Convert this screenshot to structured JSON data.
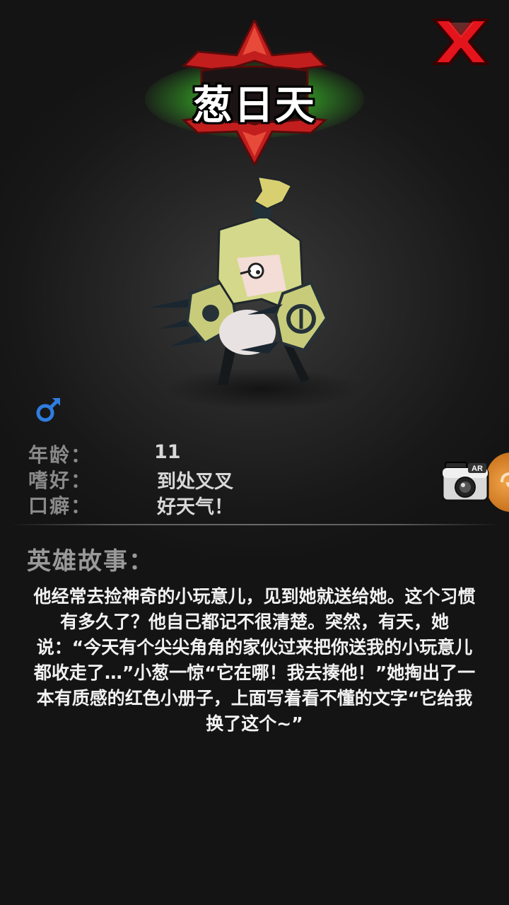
{
  "hero": {
    "name": "葱日天"
  },
  "profile": {
    "gender_icon": "male-symbol-icon",
    "gender_color": "#2f7de0",
    "rows": [
      {
        "label": "年龄：",
        "value": "11"
      },
      {
        "label": "嗜好：",
        "value": "到处叉叉"
      },
      {
        "label": "口癖：",
        "value": "好天气！"
      }
    ]
  },
  "ar_button": {
    "label": "AR",
    "icon": "camera-icon"
  },
  "story": {
    "heading": "英雄故事：",
    "text": "他经常去捡神奇的小玩意儿，见到她就送给她。这个习惯有多久了？他自己都记不很清楚。突然，有天，她说：“今天有个尖尖角角的家伙过来把你送我的小玩意儿都收走了…”小葱一惊“它在哪！我去揍他！”她掏出了一本有质感的红色小册子，上面写着看不懂的文字“它给我换了这个~”"
  },
  "colors": {
    "close_red": "#e3141c",
    "emblem_red": "#c21e1e",
    "title_glow": "#6cff4a",
    "side_tab_orange": "#e08a2e"
  }
}
